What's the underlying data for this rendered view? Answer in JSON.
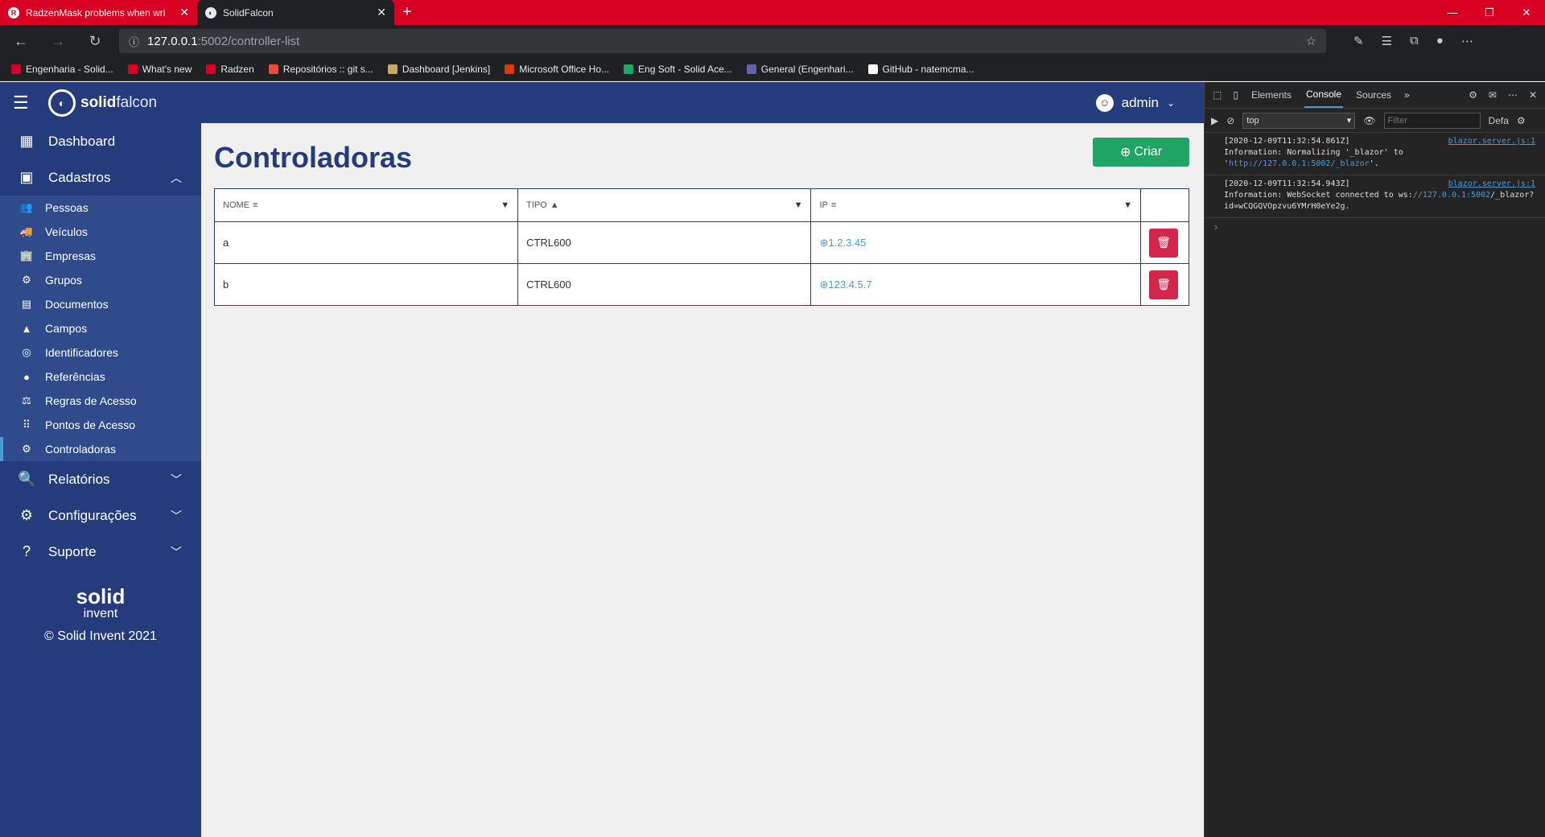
{
  "browser": {
    "tabs": [
      {
        "title": "RadzenMask problems when wri",
        "active": false
      },
      {
        "title": "SolidFalcon",
        "active": true
      }
    ],
    "new_tab": "+",
    "url_host": "127.0.0.1",
    "url_path": ":5002/controller-list",
    "bookmarks": [
      {
        "label": "Engenharia - Solid...",
        "color": "#d70022"
      },
      {
        "label": "What's new",
        "color": "#d70022"
      },
      {
        "label": "Radzen",
        "color": "#d70022"
      },
      {
        "label": "Repositórios :: git s...",
        "color": "#e84d3d"
      },
      {
        "label": "Dashboard [Jenkins]",
        "color": "#c9a66b"
      },
      {
        "label": "Microsoft Office Ho...",
        "color": "#d83b01"
      },
      {
        "label": "Eng Soft - Solid Ace...",
        "color": "#1fa566"
      },
      {
        "label": "General (Engenhari...",
        "color": "#6264a7"
      },
      {
        "label": "GitHub - natemcma...",
        "color": "#ffffff"
      }
    ]
  },
  "app": {
    "brand_solid": "solid",
    "brand_falcon": "falcon",
    "user_name": "admin",
    "nav": {
      "dashboard": "Dashboard",
      "cadastros": "Cadastros",
      "cadastros_items": [
        {
          "label": "Pessoas",
          "icon": "people-icon",
          "glyph": "👥"
        },
        {
          "label": "Veículos",
          "icon": "truck-icon",
          "glyph": "🚚"
        },
        {
          "label": "Empresas",
          "icon": "building-icon",
          "glyph": "🏢"
        },
        {
          "label": "Grupos",
          "icon": "groups-icon",
          "glyph": "⚙"
        },
        {
          "label": "Documentos",
          "icon": "id-card-icon",
          "glyph": "▤"
        },
        {
          "label": "Campos",
          "icon": "shapes-icon",
          "glyph": "▲"
        },
        {
          "label": "Identificadores",
          "icon": "fingerprint-icon",
          "glyph": "◎"
        },
        {
          "label": "Referências",
          "icon": "map-pin-icon",
          "glyph": "●"
        },
        {
          "label": "Regras de Acesso",
          "icon": "gavel-icon",
          "glyph": "⚖"
        },
        {
          "label": "Pontos de Acesso",
          "icon": "grid-dots-icon",
          "glyph": "⠿"
        },
        {
          "label": "Controladoras",
          "icon": "chip-icon",
          "glyph": "⚙"
        }
      ],
      "relatorios": "Relatórios",
      "configuracoes": "Configurações",
      "suporte": "Suporte"
    },
    "footer": {
      "logo_solid": "solid",
      "logo_invent": "invent",
      "copyright": "© Solid Invent 2021"
    },
    "page": {
      "title": "Controladoras",
      "create_label": "Criar",
      "columns": {
        "nome": "NOME",
        "tipo": "TIPO",
        "ip": "IP"
      },
      "rows": [
        {
          "nome": "a",
          "tipo": "CTRL600",
          "ip": "1.2.3.45"
        },
        {
          "nome": "b",
          "tipo": "CTRL600",
          "ip": "123.4.5.7"
        }
      ]
    }
  },
  "devtools": {
    "tabs": [
      "Elements",
      "Console",
      "Sources"
    ],
    "active_tab": "Console",
    "context": "top",
    "filter_placeholder": "Filter",
    "level": "Defa",
    "logs": [
      {
        "line1": "[2020-12-09T11:32:54.861Z]",
        "line2": "Information: Normalizing '_blazor' to '",
        "link": "http://127.0.0.1:5002/_blazor",
        "tail": "'.",
        "source": "blazor.server.js:1"
      },
      {
        "line1": "[2020-12-09T11:32:54.943Z]",
        "line2": "Information: WebSocket connected to ws:",
        "link": "//127.0.0.1:5002",
        "tail": "/_blazor?id=wCQGQVOpzvu6YMrH0eYe2g.",
        "source": "blazor.server.js:1"
      }
    ],
    "prompt": "›"
  }
}
